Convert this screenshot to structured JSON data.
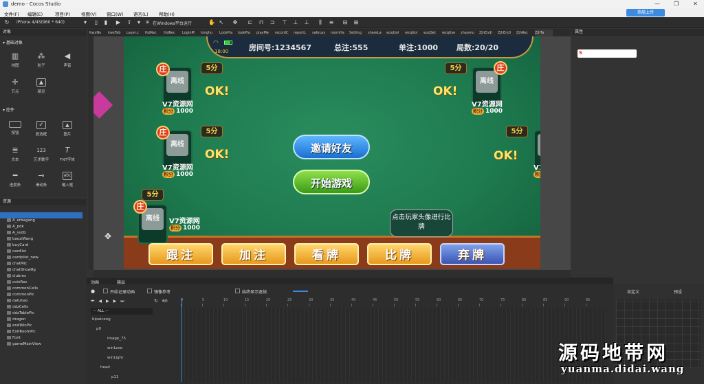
{
  "window": {
    "title": "demo - Cocos Studio",
    "publish_label": "热随上传"
  },
  "menu": [
    "文件(F)",
    "编辑(E)",
    "项目(P)",
    "视图(V)",
    "窗口(W)",
    "语言(L)",
    "帮助(H)"
  ],
  "toolbar": {
    "device": "iPhone 4/4S(960 * 640)",
    "run_target": "在Windows平台运行"
  },
  "panels": {
    "objects_title": "对象",
    "basic_section": "基础对象",
    "basic_items": [
      "地图",
      "粒子",
      "声音",
      "节点",
      "精灵"
    ],
    "controls_section": "控件",
    "control_items": [
      "按钮",
      "复选框",
      "图片",
      "文本",
      "艺术数字",
      "FNT字体",
      "进度条",
      "滑动条",
      "输入框"
    ],
    "resources_title": "资源",
    "properties_title": "属性",
    "animation_tab": "动画",
    "output_tab": "输出"
  },
  "resources": [
    "demo",
    "A_erbagang",
    "A_pdk",
    "A_sxdb",
    "baoziWang",
    "buyCard",
    "cardlist",
    "cardplist_new",
    "chatMic",
    "chatShow8g",
    "clubres",
    "coinRes",
    "commonCells",
    "commonPic",
    "dafuhao",
    "ddzCells",
    "ddzTablePic",
    "dragon",
    "endWinPic",
    "ExitRoomPic",
    "Font",
    "gameMainView"
  ],
  "tabs": [
    "KwxNo",
    "kwxTab",
    "Layer.c",
    "lhdRec",
    "lhdRec",
    "LoginM",
    "longhu",
    "LookPla",
    "lookPla",
    "playMe",
    "recordC",
    "reportL",
    "safeLay",
    "roomHa",
    "Setting",
    "shareLa",
    "wzqGol",
    "wzqGol",
    "wzqSet",
    "wzqUse",
    "zhaomu",
    "ZjhEndl",
    "ZjhEndl",
    "ZjhRec",
    "ZjhTa"
  ],
  "game": {
    "clock": "18:00",
    "room": "房间号:1234567",
    "total": "总注:555",
    "single": "单注:1000",
    "rounds": "局数:20/20",
    "banker": "庄",
    "avatar_text": "离线",
    "player_name": "V7资源网",
    "score_tag": "积分",
    "score": "1000",
    "fen": "5分",
    "ok": "OK!",
    "invite": "邀请好友",
    "start": "开始游戏",
    "tip": "点击玩家头像进行比牌",
    "actions": [
      "跟注",
      "加注",
      "看牌",
      "比牌",
      "弃牌"
    ]
  },
  "timeline": {
    "record_label": "开始记录动画",
    "onion_label": "镜像参考",
    "fps": "60",
    "loop_label": "始终显示逐帧",
    "filter": "-- ALL --",
    "nodes": [
      "bipaiceng",
      "p0",
      "Image_75",
      "winLose",
      "winLight",
      "head",
      "p11"
    ],
    "ticks": [
      "0",
      "5",
      "10",
      "15",
      "20",
      "25",
      "30",
      "35",
      "40",
      "45",
      "50",
      "55",
      "60",
      "65",
      "70",
      "75",
      "80",
      "85",
      "90",
      "95"
    ],
    "custom_label": "自定义",
    "preset_label": "预设"
  },
  "watermark": {
    "line1": "源码地带网",
    "line2": "yuanma.didai.wang"
  },
  "colors": {
    "felt": "#1e7a4f",
    "accent": "#3d8be0",
    "banker": "#e03a2a"
  }
}
